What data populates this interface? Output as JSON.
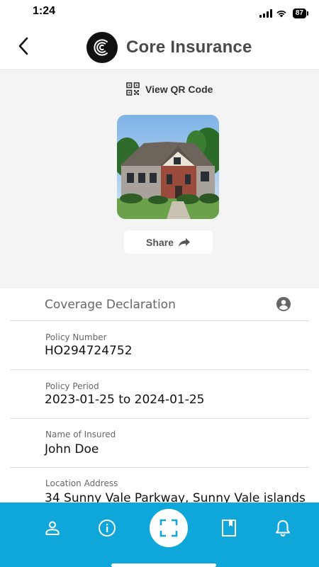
{
  "status_bar": {
    "time": "1:24",
    "battery": "87"
  },
  "header": {
    "back_icon": "chevron-left-icon",
    "logo_icon": "core-logo-icon",
    "title": "Core Insurance"
  },
  "top": {
    "qr_label": "View QR Code",
    "qr_icon": "qr-code-icon",
    "share_label": "Share",
    "share_icon": "share-arrow-icon"
  },
  "coverage": {
    "title": "Coverage Declaration",
    "fields": [
      {
        "label": "Policy Number",
        "value": "HO294724752"
      },
      {
        "label": "Policy Period",
        "value": "2023-01-25 to 2024-01-25"
      },
      {
        "label": "Name of Insured",
        "value": "John Doe"
      },
      {
        "label": "Location Address",
        "value": "34 Sunny Vale Parkway, Sunny Vale islands"
      }
    ]
  },
  "nav": {
    "items": [
      "person-icon",
      "info-icon",
      "scan-icon",
      "book-icon",
      "bell-icon"
    ]
  },
  "colors": {
    "nav_bg": "#0fa6d9",
    "top_bg": "#f4f4f4"
  }
}
